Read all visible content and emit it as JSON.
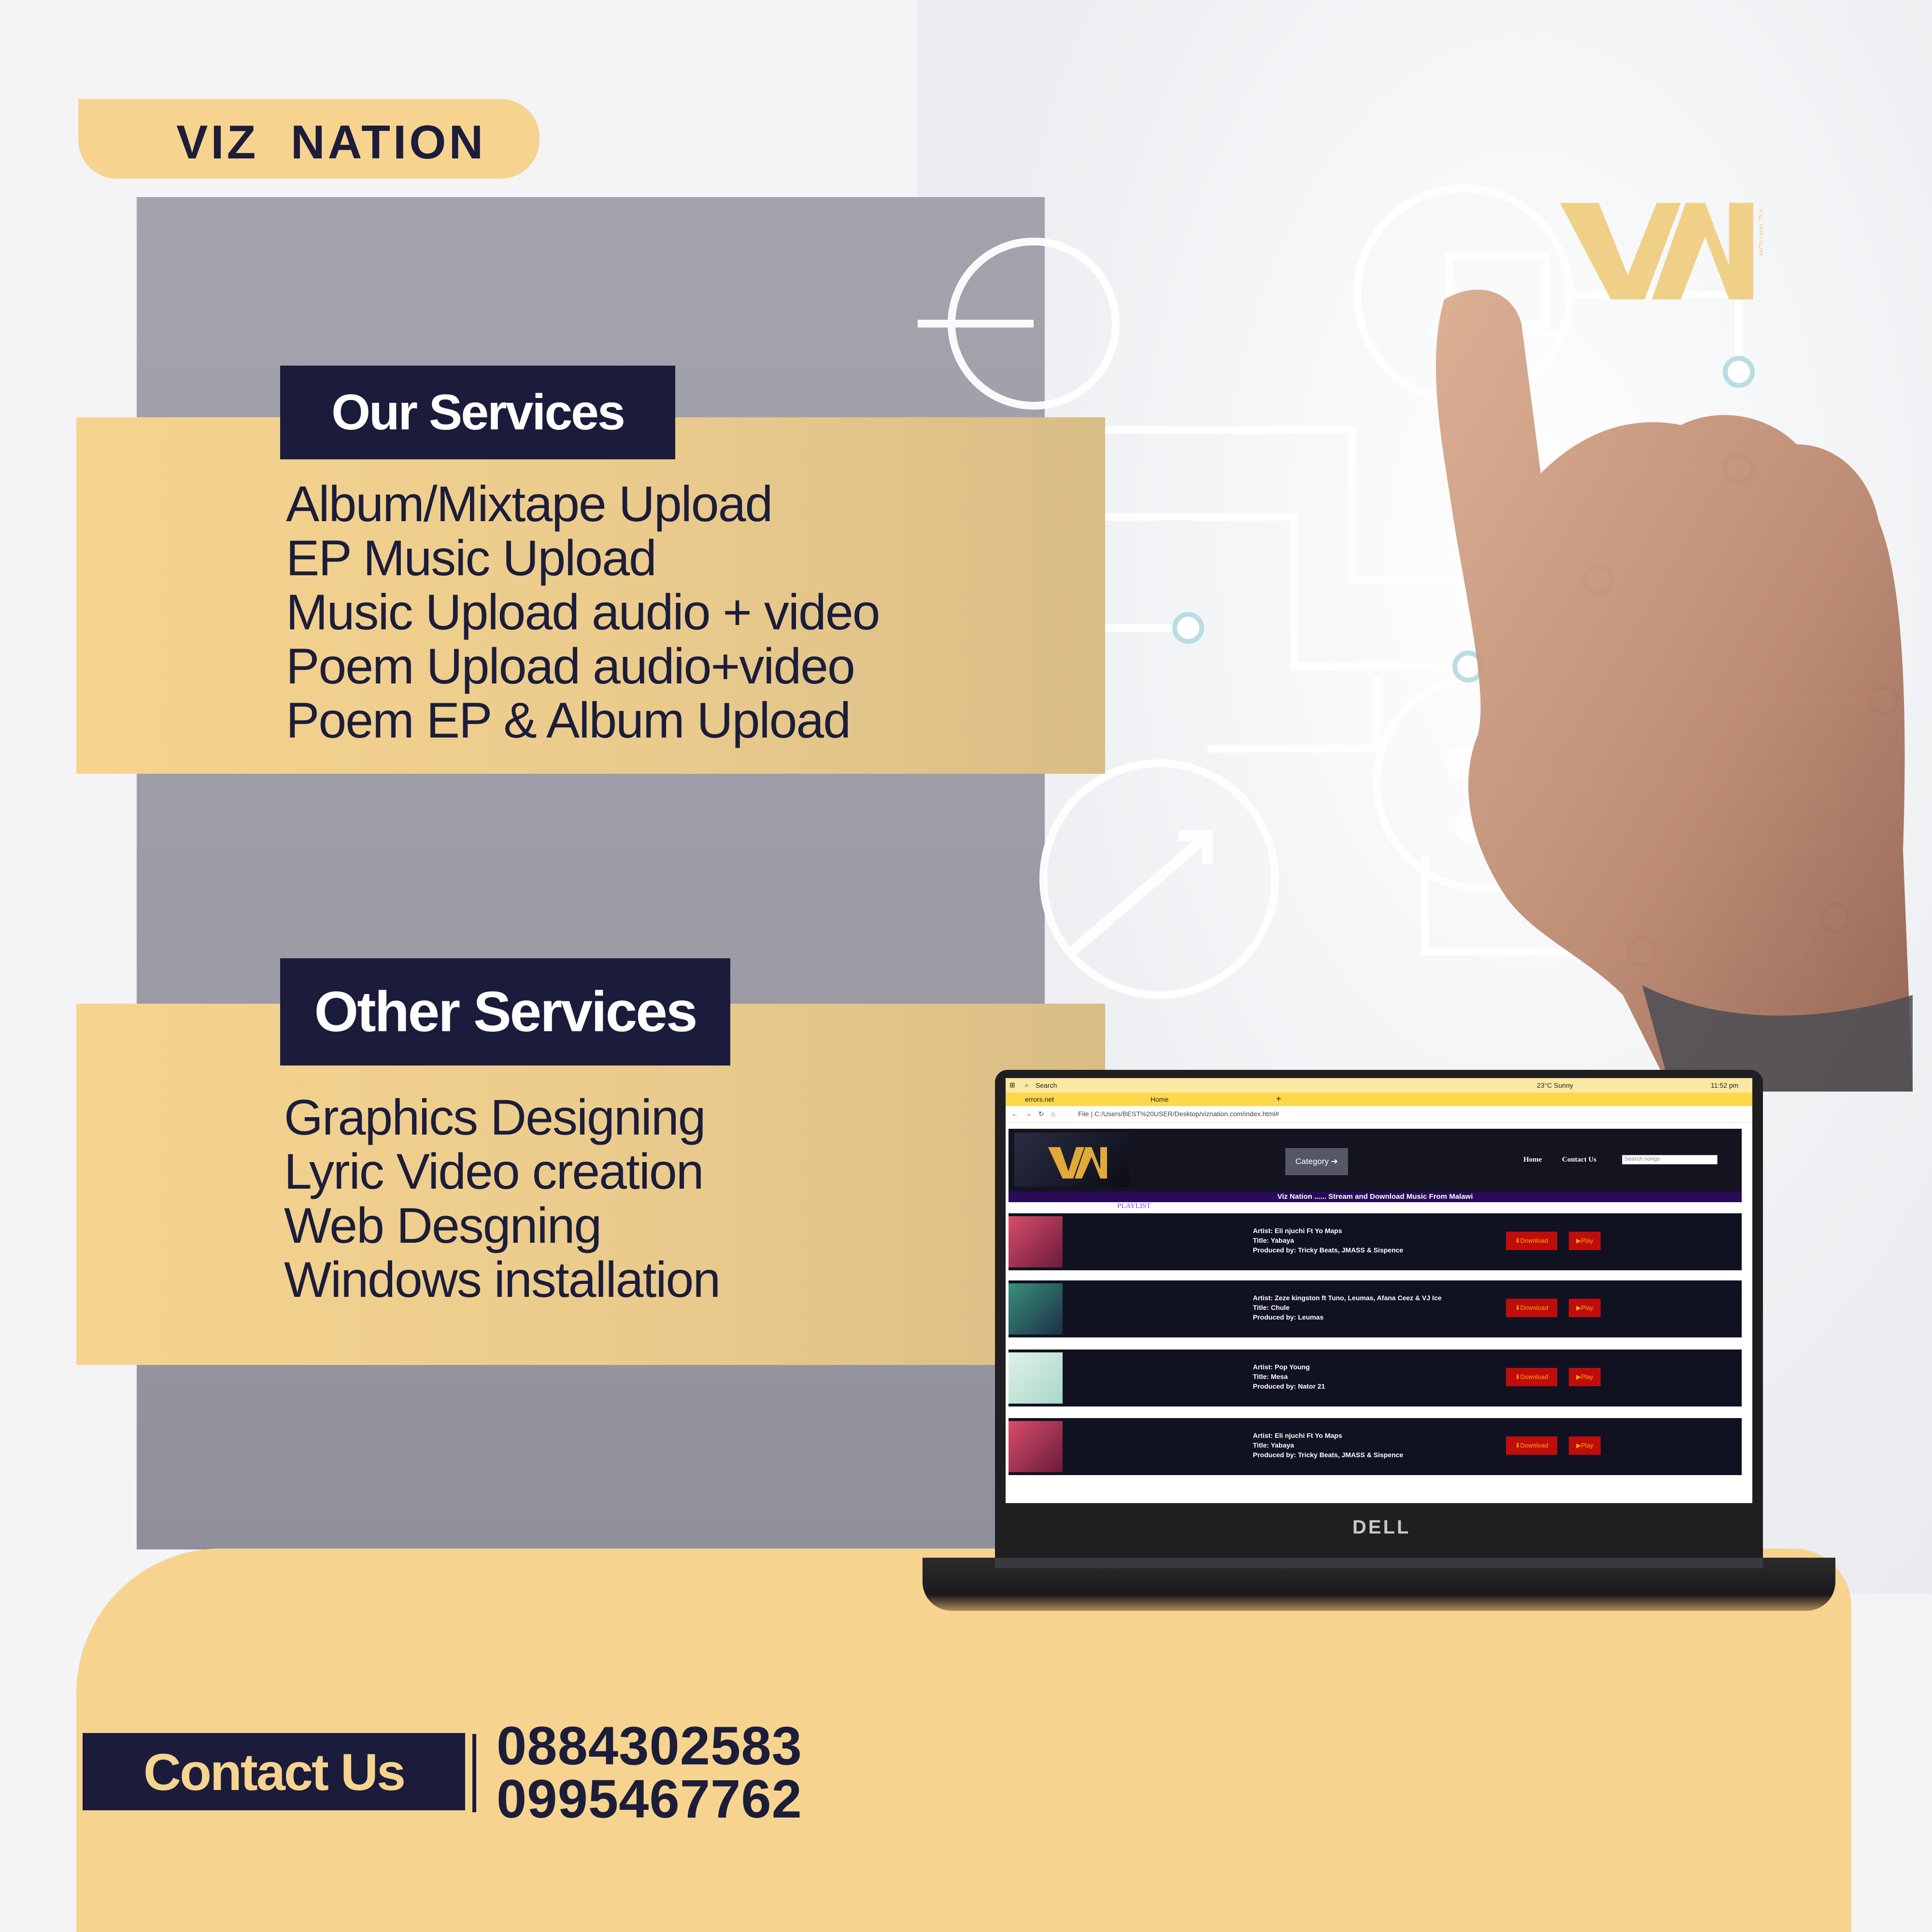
{
  "brand": {
    "name": "VIZ  NATION"
  },
  "our_services": {
    "title": "Our Services",
    "items": [
      "Album/Mixtape Upload",
      "EP Music Upload",
      "Music Upload audio + video",
      "Poem Upload audio+video",
      "Poem EP & Album Upload"
    ]
  },
  "other_services": {
    "title": "Other Services",
    "items": [
      "Graphics Designing",
      "Lyric Video creation",
      "Web Desgning",
      "Windows installation"
    ]
  },
  "contact": {
    "label": "Contact Us",
    "phones": [
      "0884302583",
      "0995467762"
    ]
  },
  "logo": {
    "letters": "VN",
    "side_text": "VIZ NATION"
  },
  "laptop": {
    "brand": "DELL",
    "taskbar": {
      "search": "Search",
      "weather": "23°C  Sunny",
      "time": "11:52 pm"
    },
    "tabs": [
      "errors.net",
      "Home"
    ],
    "address": "File  |  C:/Users/BEST%20USER/Desktop/viznation.com/index.html#",
    "site": {
      "category_button": "Category ➔",
      "nav": [
        "Home",
        "Contact Us"
      ],
      "search_placeholder": "Search songs",
      "banner": "Viz Nation ...... Stream and Download Music From Malawi",
      "playlist_label": "PLAYLIST",
      "download_label": "⬇Download",
      "play_label": "▶Play",
      "songs": [
        {
          "artist": "Artist: Eli njuchi Ft Yo Maps",
          "title": "Title: Yabaya",
          "producer": "Produced by: Tricky Beats, JMASS & Sispence"
        },
        {
          "artist": "Artist: Zeze kingston ft Tuno, Leumas, Afana Ceez & VJ Ice",
          "title": "Title: Chule",
          "producer": "Produced by: Leumas"
        },
        {
          "artist": "Artist: Pop Young",
          "title": "Title: Mesa",
          "producer": "Produced by: Nator 21"
        },
        {
          "artist": "Artist: Eli njuchi Ft Yo Maps",
          "title": "Title: Yabaya",
          "producer": "Produced by: Tricky Beats, JMASS & Sispence"
        }
      ]
    }
  },
  "colors": {
    "navy": "#1b1c3b",
    "gold": "#f6d48f",
    "grey": "#9b9ba6"
  }
}
